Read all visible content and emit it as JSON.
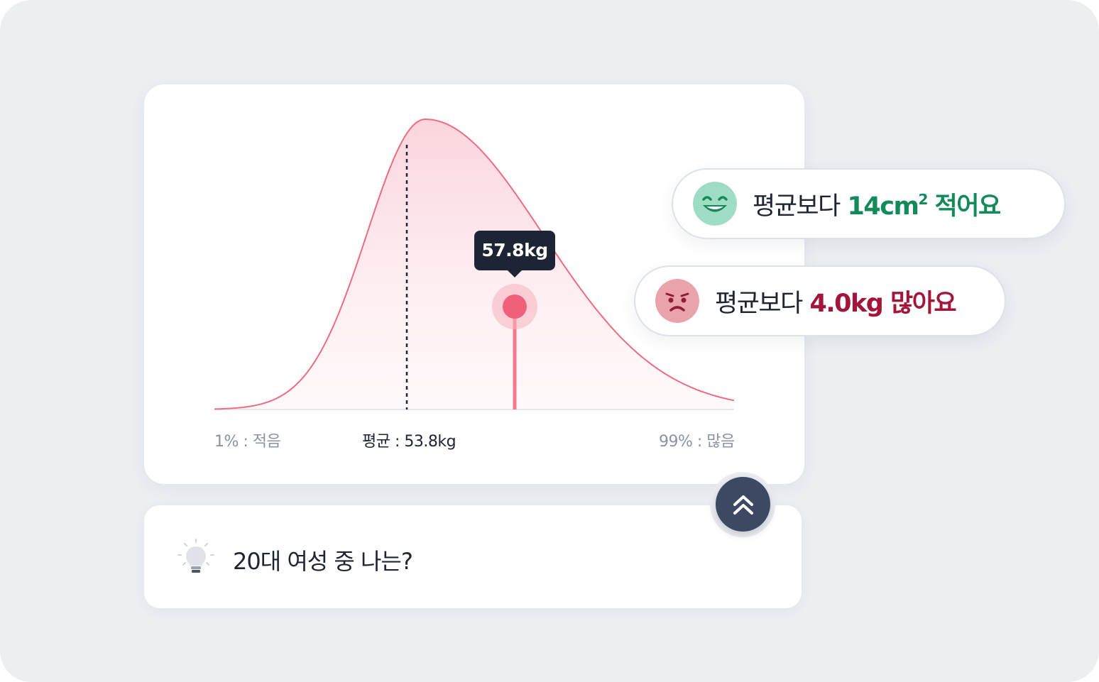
{
  "chart_data": {
    "type": "area",
    "title": "",
    "x_labels": {
      "min": "1% : 적음",
      "mean": "평균 : 53.8kg",
      "max": "99% : 많음"
    },
    "mean_value": 53.8,
    "user_value": 57.8,
    "user_value_label": "57.8kg",
    "unit": "kg",
    "colors": {
      "curve": "#ef6b80",
      "fill_top": "#fbd2db",
      "marker": "#f0607a",
      "mean_line": "#1d2433"
    }
  },
  "comparisons": [
    {
      "prefix": "평균보다",
      "value": "14cm",
      "superscript": "2",
      "suffix": "적어요",
      "sentiment": "happy",
      "icon": "smiling-face-icon",
      "color": "#128a5a"
    },
    {
      "prefix": "평균보다",
      "value": "4.0kg 많아요",
      "sentiment": "sad",
      "icon": "frowning-face-icon",
      "color": "#a3153a"
    }
  ],
  "info": {
    "question": "20대 여성 중 나는?",
    "icon": "lightbulb-icon"
  },
  "scroll_button": {
    "icon": "double-chevron-up-icon"
  }
}
